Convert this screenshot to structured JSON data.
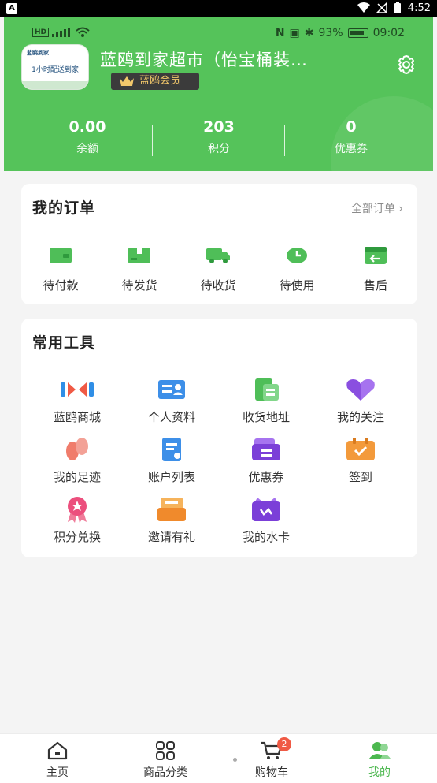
{
  "system_bar": {
    "time": "4:52"
  },
  "phone_status": {
    "battery": "93%",
    "time": "09:02"
  },
  "profile": {
    "avatar_text": "1小时配送到家",
    "avatar_brand": "蓝鸥到家",
    "shop_name": "蓝鸥到家超市（怡宝桶装…",
    "vip_label": "蓝鸥会员"
  },
  "stats": [
    {
      "value": "0.00",
      "label": "余额"
    },
    {
      "value": "203",
      "label": "积分"
    },
    {
      "value": "0",
      "label": "优惠券"
    }
  ],
  "orders": {
    "title": "我的订单",
    "all_label": "全部订单",
    "items": [
      {
        "label": "待付款",
        "icon": "wallet-icon"
      },
      {
        "label": "待发货",
        "icon": "package-icon"
      },
      {
        "label": "待收货",
        "icon": "truck-icon"
      },
      {
        "label": "待使用",
        "icon": "clock-icon"
      },
      {
        "label": "售后",
        "icon": "return-icon"
      }
    ]
  },
  "tools": {
    "title": "常用工具",
    "items": [
      {
        "label": "蓝鸥商城",
        "icon": "mall-icon"
      },
      {
        "label": "个人资料",
        "icon": "id-card-icon"
      },
      {
        "label": "收货地址",
        "icon": "address-icon"
      },
      {
        "label": "我的关注",
        "icon": "heart-icon"
      },
      {
        "label": "我的足迹",
        "icon": "footprint-icon"
      },
      {
        "label": "账户列表",
        "icon": "document-icon"
      },
      {
        "label": "优惠券",
        "icon": "coupon-icon"
      },
      {
        "label": "签到",
        "icon": "checkin-icon"
      },
      {
        "label": "积分兑换",
        "icon": "badge-icon"
      },
      {
        "label": "邀请有礼",
        "icon": "invite-icon"
      },
      {
        "label": "我的水卡",
        "icon": "water-card-icon"
      }
    ]
  },
  "bottom_nav": {
    "items": [
      {
        "label": "主页",
        "icon": "home-icon"
      },
      {
        "label": "商品分类",
        "icon": "grid-icon"
      },
      {
        "label": "购物车",
        "icon": "cart-icon",
        "badge": "2"
      },
      {
        "label": "我的",
        "icon": "user-icon",
        "active": true
      }
    ]
  },
  "colors": {
    "brand_green": "#55c35a",
    "active_green": "#4cb84f",
    "badge_red": "#f05a45"
  }
}
